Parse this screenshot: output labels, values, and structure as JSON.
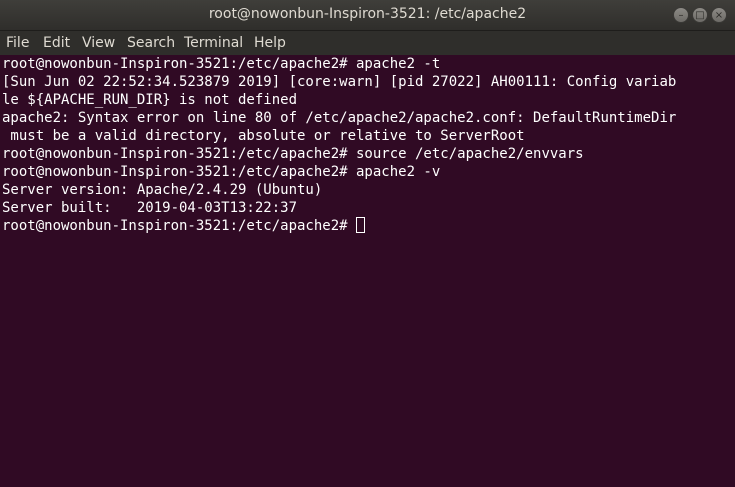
{
  "window": {
    "title": "root@nowonbun-Inspiron-3521: /etc/apache2",
    "minimize_glyph": "–",
    "maximize_glyph": "□",
    "close_glyph": "×"
  },
  "menu": {
    "file": "File",
    "edit": "Edit",
    "view": "View",
    "search": "Search",
    "terminal": "Terminal",
    "help": "Help"
  },
  "terminal": {
    "lines": [
      "root@nowonbun-Inspiron-3521:/etc/apache2# apache2 -t",
      "[Sun Jun 02 22:52:34.523879 2019] [core:warn] [pid 27022] AH00111: Config variab",
      "le ${APACHE_RUN_DIR} is not defined",
      "apache2: Syntax error on line 80 of /etc/apache2/apache2.conf: DefaultRuntimeDir",
      " must be a valid directory, absolute or relative to ServerRoot",
      "root@nowonbun-Inspiron-3521:/etc/apache2# source /etc/apache2/envvars",
      "root@nowonbun-Inspiron-3521:/etc/apache2# apache2 -v",
      "Server version: Apache/2.4.29 (Ubuntu)",
      "Server built:   2019-04-03T13:22:37"
    ],
    "prompt": "root@nowonbun-Inspiron-3521:/etc/apache2# "
  },
  "colors": {
    "background": "#300a24",
    "text": "#ffffff",
    "titlebar": "#3f3e3a"
  }
}
